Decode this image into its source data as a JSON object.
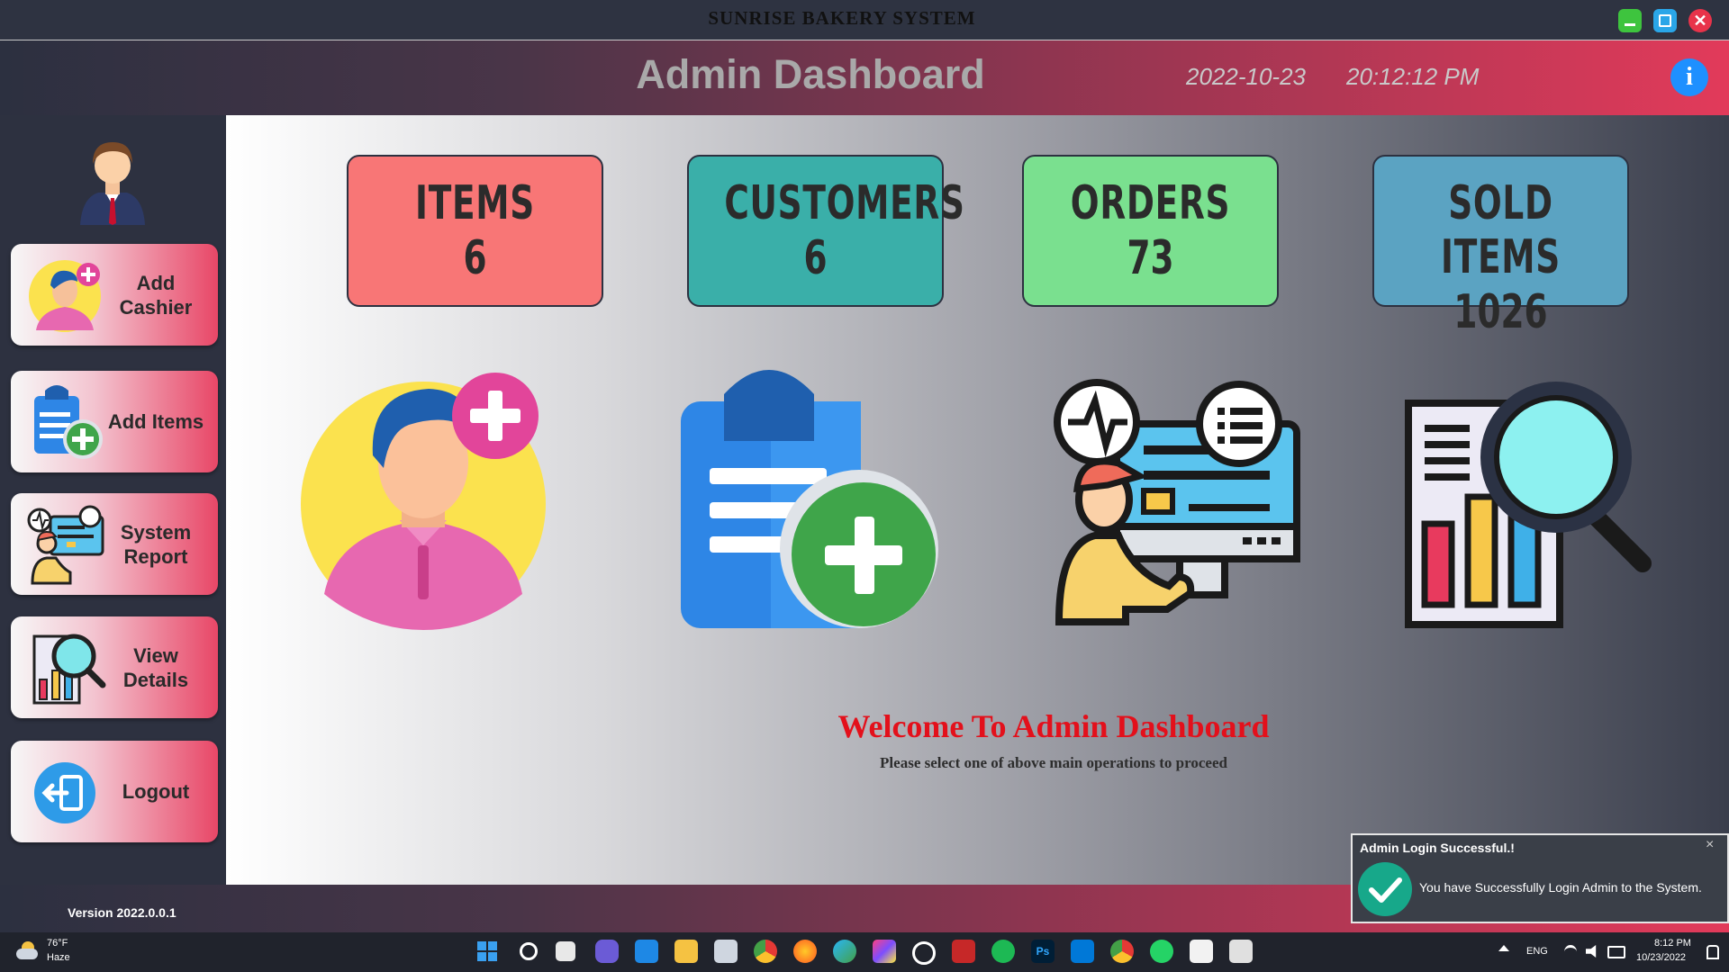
{
  "window": {
    "title": "SUNRISE BAKERY SYSTEM"
  },
  "header": {
    "title": "Admin Dashboard",
    "date": "2022-10-23",
    "time": "20:12:12 PM",
    "info_icon": "i"
  },
  "sidebar": {
    "items": [
      {
        "label": "Add Cashier",
        "icon": "add-user-icon"
      },
      {
        "label": "Add Items",
        "icon": "clipboard-add-icon"
      },
      {
        "label": "System Report",
        "icon": "monitor-report-icon"
      },
      {
        "label": "View Details",
        "icon": "magnifier-chart-icon"
      },
      {
        "label": "Logout",
        "icon": "logout-icon"
      }
    ],
    "avatar_icon": "admin-avatar-icon"
  },
  "stats": [
    {
      "title": "ITEMS",
      "value": "6",
      "color": "#f87676"
    },
    {
      "title": "CUSTOMERS",
      "value": "6",
      "color": "#3aafa9"
    },
    {
      "title": "ORDERS",
      "value": "73",
      "color": "#7ae08f"
    },
    {
      "title": "SOLD ITEMS",
      "value": "1026",
      "color": "#5ba3c2"
    }
  ],
  "main": {
    "welcome": "Welcome To Admin Dashboard",
    "subtext": "Please select one of above main operations to proceed"
  },
  "footer": {
    "version": "Version 2022.0.0.1"
  },
  "toast": {
    "title": "Admin Login Successful.!",
    "message": "You have Successfully Login Admin to the System.",
    "close": "×"
  },
  "taskbar": {
    "weather_temp": "76°F",
    "weather_desc": "Haze",
    "language": "ENG",
    "time": "8:12 PM",
    "date": "10/23/2022"
  }
}
